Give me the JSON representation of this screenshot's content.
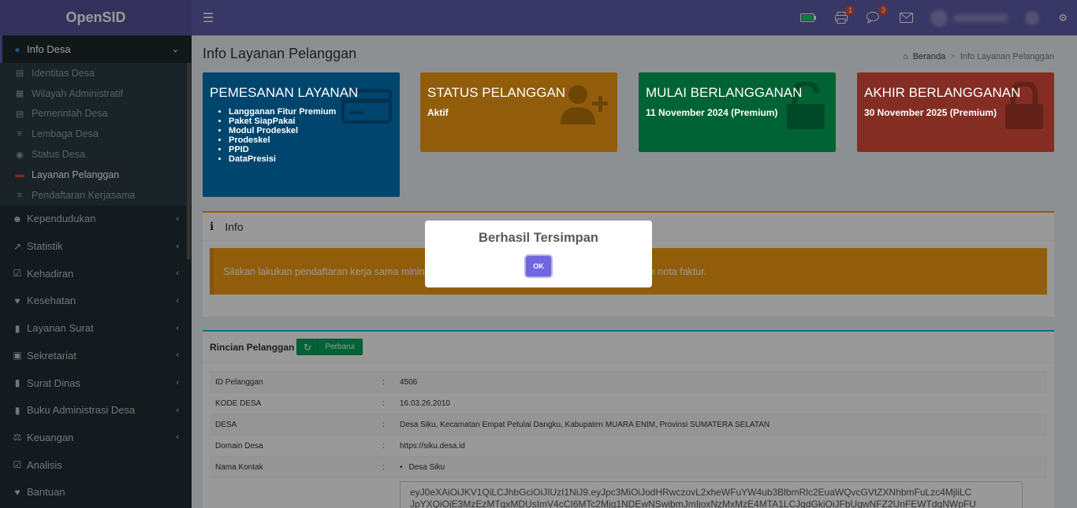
{
  "header": {
    "logo": "OpenSID",
    "menu_toggle_icon": "bars-icon",
    "notif_print_count": "1",
    "notif_chat_count": "3"
  },
  "sidebar": {
    "active_menu": "Info Desa",
    "submenu": [
      {
        "label": "Identitas Desa",
        "icon": "id-card-icon"
      },
      {
        "label": "Wilayah Administratif",
        "icon": "map-icon"
      },
      {
        "label": "Pemerintah Desa",
        "icon": "sitemap-icon"
      },
      {
        "label": "Lembaga Desa",
        "icon": "list-icon"
      },
      {
        "label": "Status Desa",
        "icon": "dot-circle-icon"
      },
      {
        "label": "Layanan Pelanggan",
        "icon": "credit-card-icon"
      },
      {
        "label": "Pendaftaran Kerjasama",
        "icon": "list-icon"
      }
    ],
    "items": [
      {
        "label": "Kependudukan",
        "icon": "users-icon"
      },
      {
        "label": "Statistik",
        "icon": "line-chart-icon"
      },
      {
        "label": "Kehadiran",
        "icon": "calendar-check-icon"
      },
      {
        "label": "Kesehatan",
        "icon": "heartbeat-icon"
      },
      {
        "label": "Layanan Surat",
        "icon": "book-icon"
      },
      {
        "label": "Sekretariat",
        "icon": "archive-icon"
      },
      {
        "label": "Surat Dinas",
        "icon": "book-icon"
      },
      {
        "label": "Buku Administrasi Desa",
        "icon": "book-icon"
      },
      {
        "label": "Keuangan",
        "icon": "balance-scale-icon"
      },
      {
        "label": "Analisis",
        "icon": "check-square-icon"
      },
      {
        "label": "Bantuan",
        "icon": "heart-icon"
      }
    ]
  },
  "page": {
    "title": "Info Layanan Pelanggan",
    "breadcrumb_home": "Beranda",
    "breadcrumb_current": "Info Layanan Pelanggan"
  },
  "boxes": {
    "pemesanan": {
      "title": "PEMESANAN LAYANAN",
      "items": [
        "Langganan Fitur Premium",
        "Paket SiapPakai",
        "Modul Prodeskel",
        "Prodeskel",
        "PPID",
        "DataPresisi"
      ],
      "color": "#0073b7"
    },
    "status": {
      "title": "STATUS PELANGGAN",
      "value": "Aktif",
      "color": "#f39c12"
    },
    "mulai": {
      "title": "MULAI BERLANGGANAN",
      "value": "11 November 2024 (Premium)",
      "color": "#00a65a"
    },
    "akhir": {
      "title": "AKHIR BERLANGGANAN",
      "value": "30 November 2025 (Premium)",
      "color": "#dd4b39"
    }
  },
  "info_card": {
    "title": "Info",
    "alert_left": "Silakan lakukan pendaftaran kerja sama minin",
    "alert_right": "k nota faktur."
  },
  "detail": {
    "title": "Rincian Pelanggan",
    "refresh_label": "Perbarui",
    "rows": [
      {
        "label": "ID Pelanggan",
        "sep": ":",
        "value": "4506"
      },
      {
        "label": "KODE DESA",
        "sep": ":",
        "value": "16.03.26.2010"
      },
      {
        "label": "DESA",
        "sep": ":",
        "value": "Desa Siku, Kecamatan Empat Petulai Dangku, Kabupaten MUARA ENIM, Provinsi SUMATERA SELATAN"
      },
      {
        "label": "Domain Desa",
        "sep": ":",
        "value": "https://siku.desa.id"
      },
      {
        "label": "Nama Kontak",
        "sep": ":",
        "value": "Desa Siku"
      }
    ],
    "token_line1": "eyJ0eXAiOiJKV1QiLCJhbGciOiJIUzI1NiJ9.eyJpc3MiOiJodHRwczovL2xheWFuYW4ub3BlbmRlc2EuaWQvcGVtZXNhbmFuLzc4MjliLC",
    "token_line2": "JpYXQiOjE3MzEzMTgxMDUsImV4cCI6MTc2Mjg1NDEwNSwibmJmIjoxNzMxMzE4MTA1LCJqdGkiOiJFbUgwNFZ2UnFEWTdqNWpFU"
  },
  "modal": {
    "title": "Berhasil Tersimpan",
    "ok_label": "OK"
  }
}
